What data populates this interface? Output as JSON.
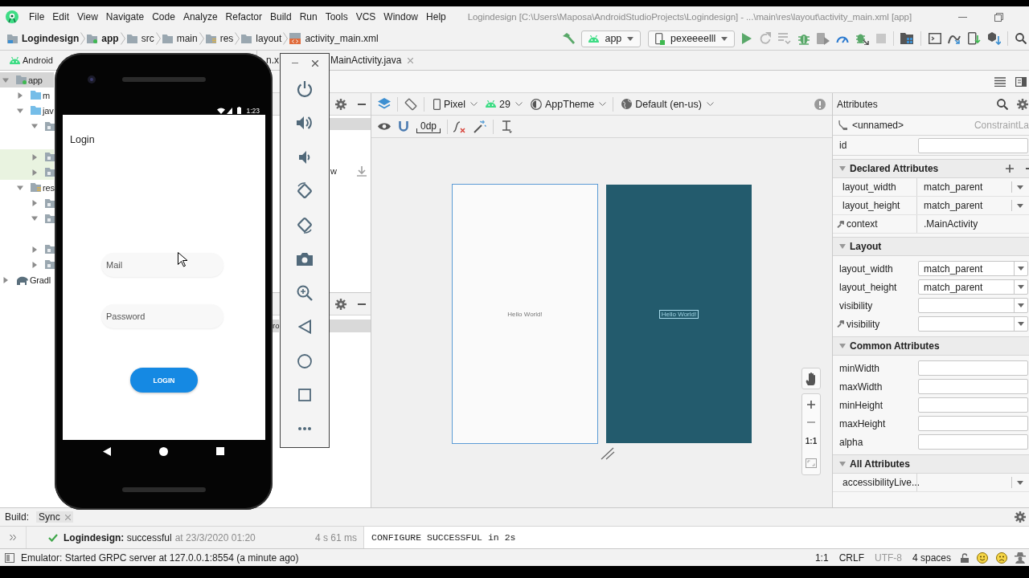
{
  "menu_bar": {
    "items": [
      "File",
      "Edit",
      "View",
      "Navigate",
      "Code",
      "Analyze",
      "Refactor",
      "Build",
      "Run",
      "Tools",
      "VCS",
      "Window",
      "Help"
    ],
    "title": "Logindesign [C:\\Users\\Maposa\\AndroidStudioProjects\\Logindesign] - ...\\main\\res\\layout\\activity_main.xml [app]"
  },
  "navigation_bar": {
    "breadcrumbs": [
      {
        "label": "Logindesign",
        "kind": "project"
      },
      {
        "label": "app",
        "kind": "module"
      },
      {
        "label": "src",
        "kind": "folder"
      },
      {
        "label": "main",
        "kind": "folder"
      },
      {
        "label": "res",
        "kind": "resources"
      },
      {
        "label": "layout",
        "kind": "folder"
      },
      {
        "label": "activity_main.xml",
        "kind": "layout_file"
      }
    ],
    "run_configuration": "app",
    "device": "pexeeeelll"
  },
  "project_pane": {
    "view": "Android",
    "tree": [
      {
        "label": "app",
        "kind": "module",
        "selected": true,
        "highlighted": false,
        "expanded": true,
        "children": [
          {
            "label": "m",
            "kind": "source_folder",
            "selected": false,
            "highlighted": false,
            "expanded": false
          },
          {
            "label": "jav",
            "kind": "source_folder",
            "selected": false,
            "highlighted": false,
            "expanded": true,
            "children": [
              {
                "kind": "package",
                "selected": false,
                "highlighted": false,
                "expanded": true
              },
              {
                "kind": "package",
                "selected": false,
                "highlighted": true,
                "expanded": false
              },
              {
                "kind": "package",
                "selected": false,
                "highlighted": true,
                "expanded": false
              }
            ]
          },
          {
            "label": "res",
            "kind": "resources",
            "selected": false,
            "highlighted": false,
            "expanded": true,
            "children": [
              {
                "kind": "package",
                "selected": false,
                "highlighted": false,
                "expanded": false
              },
              {
                "kind": "package",
                "selected": false,
                "highlighted": false,
                "expanded": true
              },
              {
                "kind": "package",
                "selected": false,
                "highlighted": false,
                "expanded": false
              },
              {
                "kind": "package",
                "selected": false,
                "highlighted": false,
                "expanded": false
              }
            ]
          }
        ]
      },
      {
        "label": "Gradl",
        "kind": "gradle",
        "selected": false,
        "highlighted": false,
        "expanded": false
      }
    ]
  },
  "editor": {
    "tabs": [
      {
        "label": "n.x",
        "closable": false
      },
      {
        "label": "MainActivity.java",
        "closable": true
      }
    ],
    "palette": {
      "category_selected": true,
      "item_text": "w"
    },
    "component_tree": {
      "root_selected": true,
      "item_text": "ro"
    },
    "toolbar": {
      "device": "Pixel",
      "api_level": "29",
      "theme": "AppTheme",
      "locale": "Default (en-us)",
      "default_margin": "0dp"
    },
    "canvas": {
      "design_text": "Hello World!",
      "blueprint_text": "Hello World!",
      "zoom_actual_size": "1:1"
    }
  },
  "attributes": {
    "title": "Attributes",
    "component": "<unnamed>",
    "component_class": "ConstraintLa",
    "id_label": "id",
    "sections": [
      {
        "title": "Declared Attributes",
        "kind": "declared",
        "expanded": true,
        "addable": true,
        "rows": [
          {
            "name": "layout_width",
            "value": "match_parent",
            "dropdown": true,
            "tool": false
          },
          {
            "name": "layout_height",
            "value": "match_parent",
            "dropdown": true,
            "tool": false
          },
          {
            "name": "context",
            "value": ".MainActivity",
            "dropdown": false,
            "tool": true
          }
        ]
      },
      {
        "title": "Layout",
        "kind": "editor",
        "expanded": true,
        "addable": false,
        "rows": [
          {
            "name": "layout_width",
            "value": "match_parent",
            "dropdown": true,
            "tool": false
          },
          {
            "name": "layout_height",
            "value": "match_parent",
            "dropdown": true,
            "tool": false
          },
          {
            "name": "visibility",
            "dropdown": true,
            "tool": false
          },
          {
            "name": "visibility",
            "dropdown": true,
            "tool": true
          }
        ]
      },
      {
        "title": "Common Attributes",
        "kind": "editor",
        "expanded": true,
        "addable": false,
        "rows": [
          {
            "name": "minWidth",
            "dropdown": false,
            "tool": false
          },
          {
            "name": "maxWidth",
            "dropdown": false,
            "tool": false
          },
          {
            "name": "minHeight",
            "dropdown": false,
            "tool": false
          },
          {
            "name": "maxHeight",
            "dropdown": false,
            "tool": false
          },
          {
            "name": "alpha",
            "dropdown": false,
            "tool": false
          }
        ]
      },
      {
        "title": "All Attributes",
        "kind": "declared",
        "expanded": true,
        "addable": false,
        "rows": [
          {
            "name": "accessibilityLive...",
            "dropdown": true,
            "tool": false
          }
        ]
      }
    ]
  },
  "build": {
    "title": "Build:",
    "tabs": [
      {
        "label": "Sync",
        "selected": true
      }
    ],
    "message": "**Logindesign:** successful",
    "timestamp": "at 23/3/2020 01:20",
    "duration": "4 s 61 ms",
    "console": "CONFIGURE SUCCESSFUL in 2s"
  },
  "status_bar": {
    "message": "Emulator: Started GRPC server at 127.0.0.1:8554 (a minute ago)",
    "items": [
      {
        "label": "1:1",
        "disabled": false
      },
      {
        "label": "CRLF",
        "disabled": false
      },
      {
        "label": "UTF-8",
        "disabled": true
      },
      {
        "label": "4 spaces",
        "disabled": false
      }
    ]
  },
  "emulator": {
    "status_time": "1:23",
    "app_title": "Login",
    "fields": [
      {
        "placeholder": "Mail"
      },
      {
        "placeholder": "Password"
      }
    ],
    "button": "LOGIN"
  }
}
